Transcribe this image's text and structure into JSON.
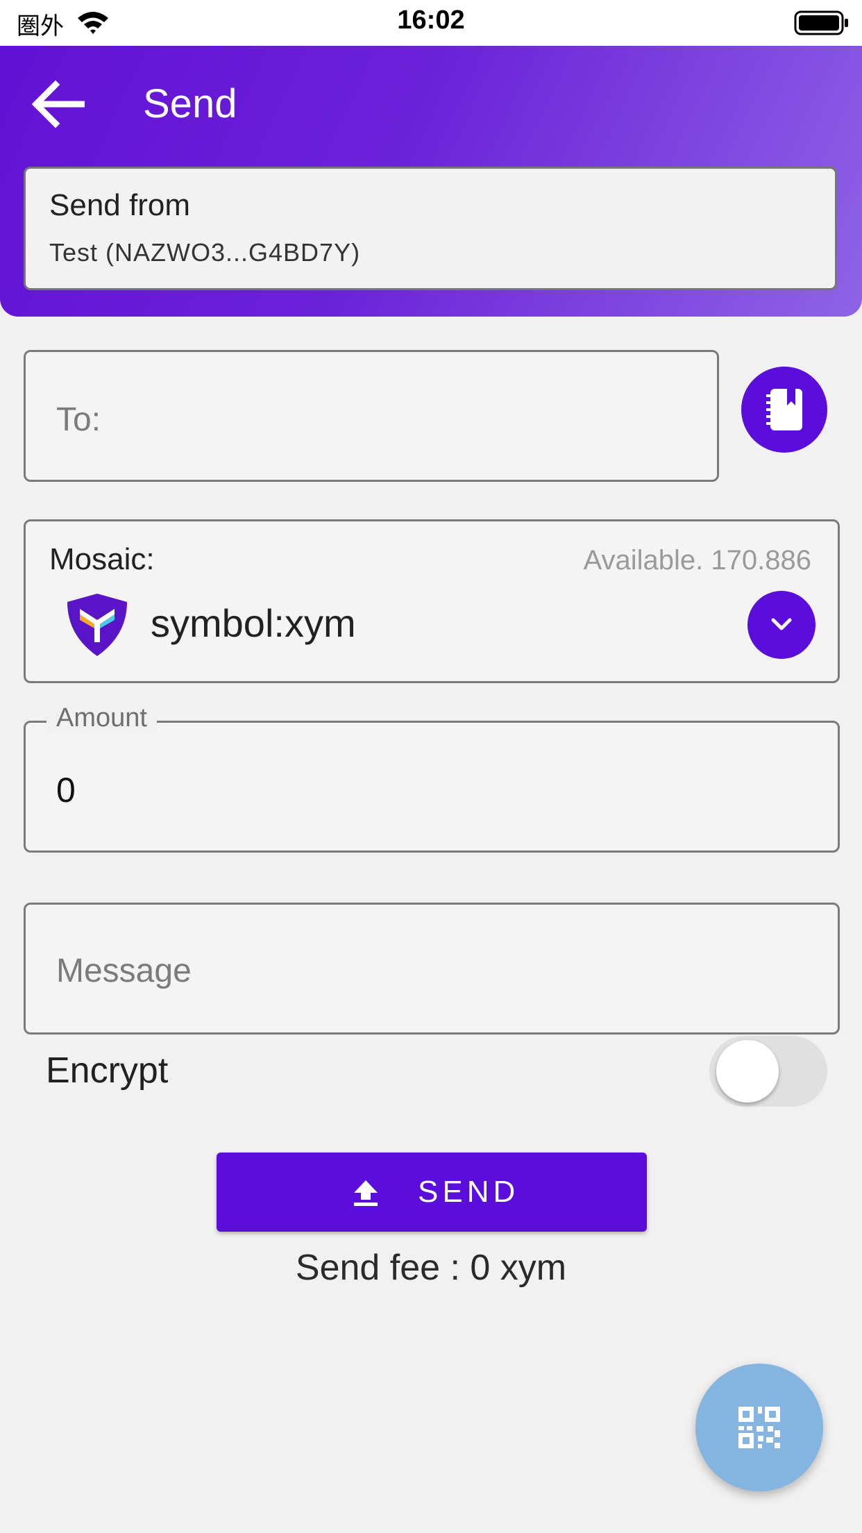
{
  "status_bar": {
    "carrier": "圏外",
    "time": "16:02"
  },
  "header": {
    "title": "Send",
    "send_from_label": "Send from",
    "send_from_value": "Test (NAZWO3...G4BD7Y)"
  },
  "form": {
    "to_placeholder": "To:",
    "mosaic_label": "Mosaic:",
    "available": "Available. 170.886",
    "mosaic_value": "symbol:xym",
    "amount_label": "Amount",
    "amount_value": "0",
    "message_placeholder": "Message",
    "encrypt_label": "Encrypt",
    "encrypt_on": false
  },
  "actions": {
    "send_label": "SEND",
    "send_fee": "Send fee : 0 xym"
  },
  "icons": {
    "back": "arrow-left-icon",
    "contacts": "address-book-icon",
    "dropdown": "chevron-down-icon",
    "upload": "upload-icon",
    "qr": "qr-code-icon",
    "token": "symbol-logo-icon"
  },
  "colors": {
    "primary": "#5b0ddb",
    "header_gradient_start": "#6211d4",
    "header_gradient_end": "#8f63e6",
    "fab": "#84b4e0",
    "background": "#f1f1f1"
  }
}
